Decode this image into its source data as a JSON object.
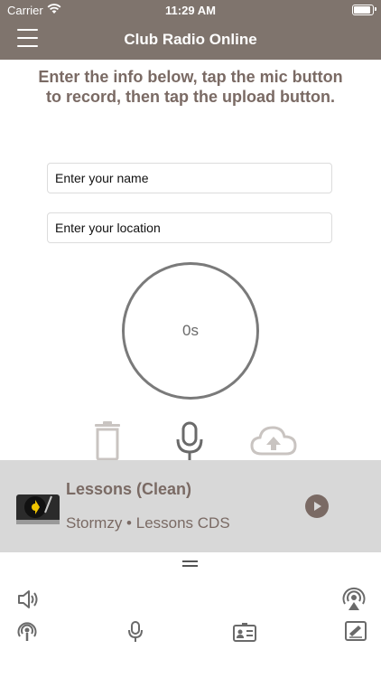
{
  "status_bar": {
    "carrier": "Carrier",
    "time": "11:29 AM"
  },
  "nav": {
    "title": "Club Radio Online"
  },
  "instructions": "Enter the info below, tap the mic button to record, then tap the upload button.",
  "form": {
    "name_placeholder": "Enter your name",
    "location_placeholder": "Enter your location"
  },
  "recorder": {
    "timer": "0s"
  },
  "player": {
    "track_title": "Lessons (Clean)",
    "track_subtitle": "Stormzy • Lessons CDS"
  },
  "colors": {
    "nav_bg": "#7f746d",
    "accent_text": "#7a6a64",
    "player_bg": "#d8d8d8"
  },
  "icons": {
    "controls": [
      "trash-icon",
      "microphone-icon",
      "cloud-upload-icon"
    ],
    "bottom_bar": [
      "speaker-icon",
      "airplay-icon",
      "podcast-icon",
      "microphone-icon",
      "contact-card-icon",
      "signature-icon"
    ]
  }
}
